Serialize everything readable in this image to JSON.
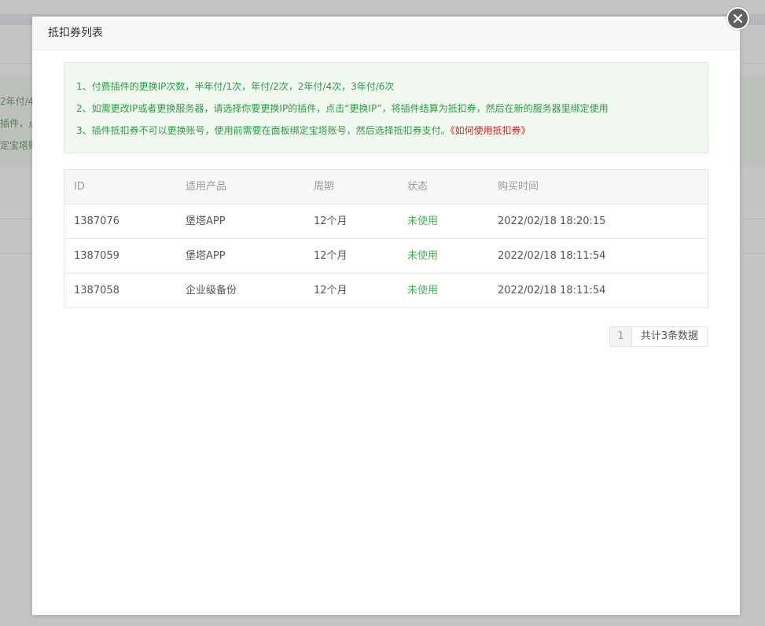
{
  "background": {
    "fragments": [
      "2年付/4",
      "插件，点",
      "定宝塔账"
    ]
  },
  "modal": {
    "title": "抵扣券列表"
  },
  "notice": {
    "line1": "1、付费插件的更换IP次数，半年付/1次，年付/2次，2年付/4次，3年付/6次",
    "line2": "2、如需更改IP或者更换服务器，请选择你要更换IP的插件，点击“更换IP”，将插件结算为抵扣券，然后在新的服务器里绑定使用",
    "line3": "3、插件抵扣券不可以更换账号，使用前需要在面板绑定宝塔账号，然后选择抵扣券支付。",
    "link": "《如何使用抵扣券》"
  },
  "table": {
    "headers": [
      "ID",
      "适用产品",
      "周期",
      "状态",
      "购买时间"
    ],
    "rows": [
      {
        "id": "1387076",
        "product": "堡塔APP",
        "period": "12个月",
        "status": "未使用",
        "time": "2022/02/18 18:20:15"
      },
      {
        "id": "1387059",
        "product": "堡塔APP",
        "period": "12个月",
        "status": "未使用",
        "time": "2022/02/18 18:11:54"
      },
      {
        "id": "1387058",
        "product": "企业级备份",
        "period": "12个月",
        "status": "未使用",
        "time": "2022/02/18 18:11:54"
      }
    ]
  },
  "pager": {
    "current_page": "1",
    "total_text": "共计3条数据"
  },
  "colors": {
    "notice_text": "#2e9b47",
    "notice_link": "#e11d1d",
    "status_unused": "#49b05b",
    "close_button": "#616161"
  },
  "icons": {
    "close": "close-icon"
  }
}
